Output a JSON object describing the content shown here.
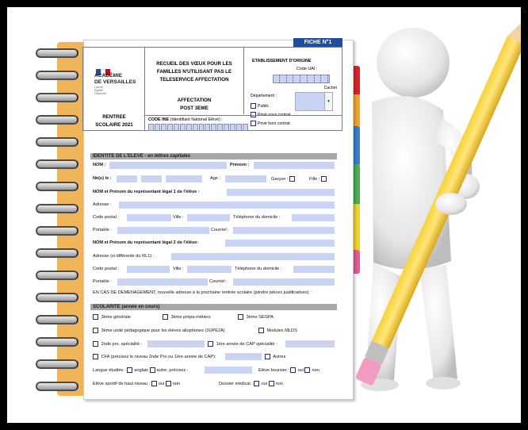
{
  "fiche": {
    "label": "FICHE N°1"
  },
  "header": {
    "academie": [
      "ACADÉMIE",
      "DE VERSAILLES"
    ],
    "devise": [
      "Liberté",
      "Égalité",
      "Fraternité"
    ],
    "rentree": [
      "RENTREE",
      "SCOLAIRE 2021"
    ],
    "title": [
      "RECUEIL DES VŒUX POUR LES",
      "FAMILLES N'UTILISANT PAS LE",
      "TELESERVICE AFFECTATION"
    ],
    "subtitle": [
      "AFFECTATION",
      "POST 3EME"
    ],
    "etablissement_label": "ETABLISSEMENT D'ORIGINE",
    "code_uai_label": "Code UAI :",
    "cachet_label": "Cachet",
    "departement_label": "Département :",
    "public_label": "Public",
    "prive_sous_contrat_label": "Privé sous contrat",
    "prive_hors_contrat_label": "Privé hors contrat",
    "code_ine_label": "CODE INE",
    "code_ine_hint": "(Identifiant National Elève) :"
  },
  "identite": {
    "section_title": "IDENTITE DE L'ELEVE",
    "section_note": " - en lettres capitales",
    "nom": "NOM :",
    "prenom": "Prénom :",
    "ne_le": "Né(e) le :",
    "age": "Age :",
    "garcon": "Garçon :",
    "fille": "Fille :",
    "rl1": "NOM et Prénom du représentant légal 1 de l'élève :",
    "adresse": "Adresse :",
    "code_postal": "Code postal :",
    "ville": "Ville :",
    "tel_domicile": "Téléphone du domicile :",
    "portable": "Portable :",
    "courriel": "Courriel :",
    "rl2": "NOM et Prénom du représentant légal 2 de l'élève:",
    "adresse_rl1": "Adresse (si différente du RL1) :",
    "code_postal_2": "Code postal :",
    "ville_2": "Ville :",
    "tel_domicile_2": "Téléphone du domicile :",
    "portable_2": "Portable :",
    "courriel_2": "Courriel :",
    "demenagement": "EN CAS DE DEMENAGEMENT, nouvelle adresse à la prochaine rentrée scolaire (joindre pièces justificatives) :"
  },
  "scolarite": {
    "section_title": "SCOLARITE (année en cours)",
    "opt_generale": "3ème générale",
    "opt_prepa": "3ème prépa-métiers",
    "opt_segpa": "3ème SEGPA",
    "opt_upe2a": "3ème unité pédagogique pour les élèves allophones (3UPE2A)",
    "opt_mlds": "Modules MLDS",
    "opt_2pro": "2nde pro. spécialité :",
    "opt_1cap": "1ère année de CAP spécialité :",
    "opt_cfa": "CFA (précisez le niveau 2nde Pro ou 1ère année de CAP):",
    "opt_autres": "Autres",
    "langue": "Langue étudiée :",
    "anglais": "anglais",
    "autre_precisez": "autre, précisez :",
    "boursier": "Elève boursier :",
    "oui": "oui",
    "non": "non",
    "sportif": "Elève sportif de haut niveau :",
    "oui_2": "oui",
    "non_2": "non",
    "dossier_medical": "Dossier médical :",
    "oui_3": "oui",
    "non_3": "non"
  },
  "colors": {
    "accent": "#1f4e9e",
    "field": "#c9d3f3",
    "tabs": [
      "#d7242a",
      "#f2a52c",
      "#3a7fd0",
      "#4caf50",
      "#f2d230",
      "#e45c9a"
    ]
  }
}
